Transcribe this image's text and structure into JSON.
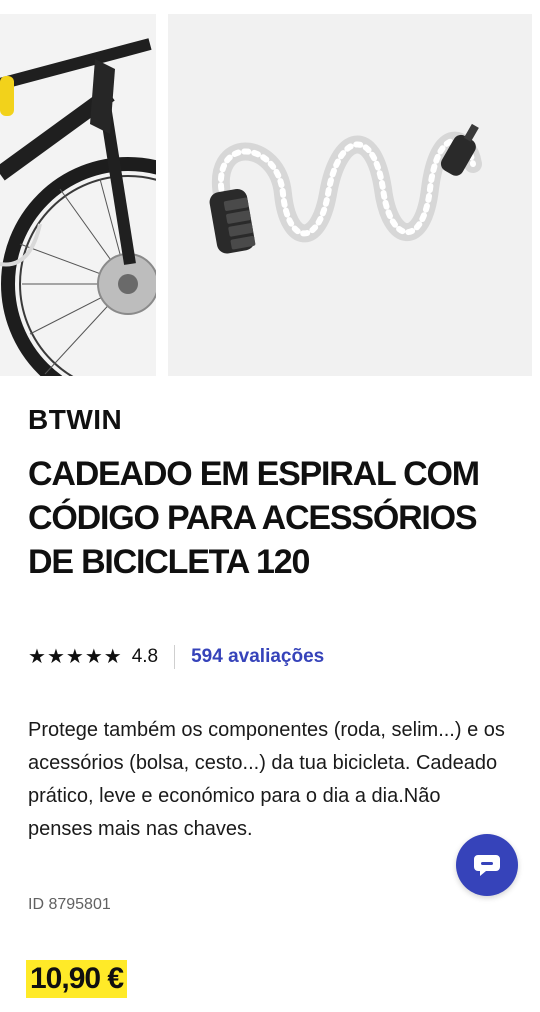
{
  "product": {
    "brand": "BTWIN",
    "title": "CADEADO EM ESPIRAL COM CÓDIGO PARA ACESSÓRIOS DE BICICLETA 120",
    "rating": {
      "stars": 5,
      "score": "4.8",
      "reviews_label": "594 avaliações"
    },
    "description": "Protege também os componentes (roda, selim...) e os acessórios (bolsa, cesto...) da tua bicicleta. Cadeado prático, leve e económico para o dia a dia.Não penses mais nas chaves.",
    "id_label": "ID 8795801",
    "price": "10,90 €"
  },
  "gallery": {
    "images": [
      "bicycle-photo",
      "spiral-cable-lock-photo"
    ]
  },
  "chat": {
    "icon": "chat-bubble-icon"
  },
  "colors": {
    "accent": "#3643ba",
    "price_highlight": "#ffea28",
    "text": "#101010"
  }
}
